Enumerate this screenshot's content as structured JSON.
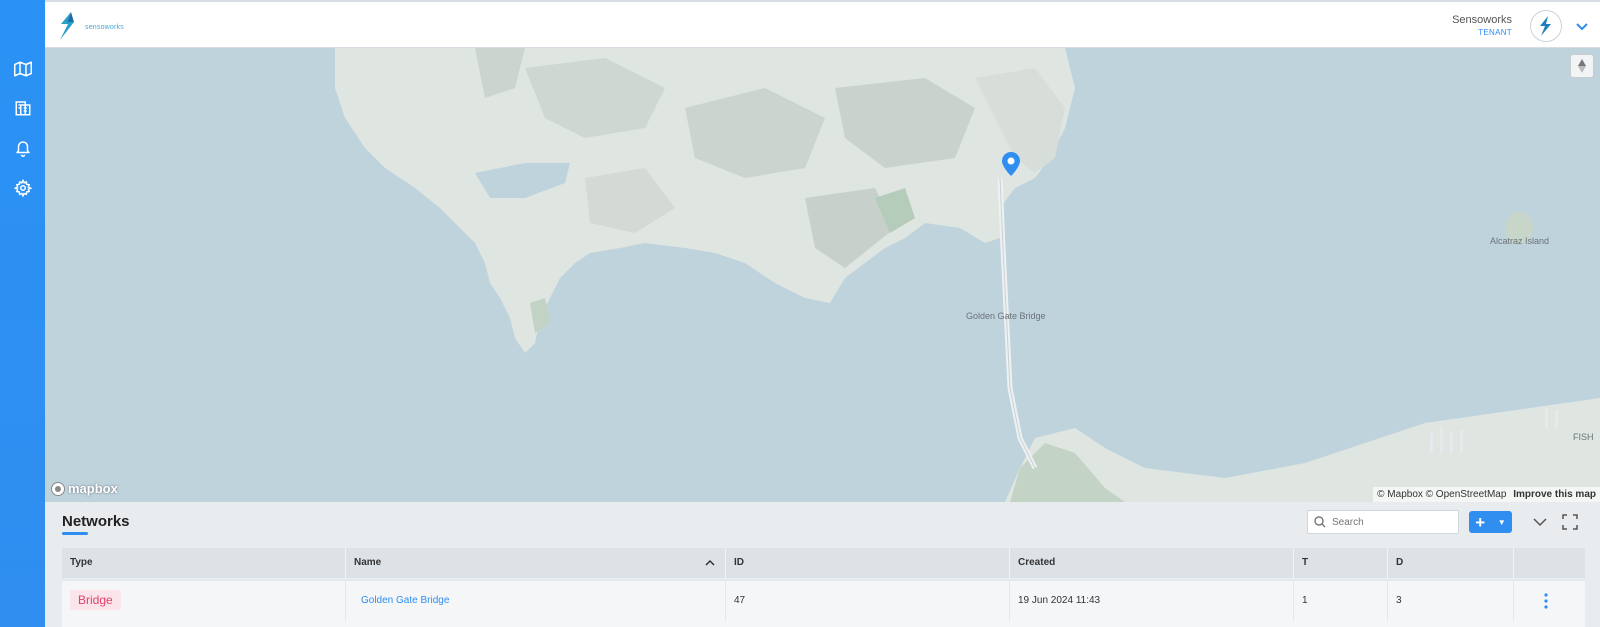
{
  "header": {
    "logo_text": "sensoworks",
    "tenant_name": "Sensoworks",
    "tenant_role": "TENANT"
  },
  "sidebar": {
    "items": [
      {
        "icon": "map-icon"
      },
      {
        "icon": "buildings-icon"
      },
      {
        "icon": "bell-icon"
      },
      {
        "icon": "gear-icon"
      }
    ]
  },
  "map": {
    "labels": {
      "bridge": "Golden Gate Bridge",
      "island": "Alcatraz Island",
      "fisherman": "FISH"
    },
    "mapbox_logo": "mapbox",
    "attribution": "© Mapbox © OpenStreetMap",
    "improve": "Improve this map"
  },
  "networks": {
    "title": "Networks",
    "search_placeholder": "Search",
    "add_label": "+",
    "columns": {
      "type": "Type",
      "name": "Name",
      "id": "ID",
      "created": "Created",
      "t": "T",
      "d": "D"
    },
    "rows": [
      {
        "type": "Bridge",
        "name": "Golden Gate Bridge",
        "id": "47",
        "created": "19 Jun 2024 11:43",
        "t": "1",
        "d": "3"
      }
    ]
  },
  "colors": {
    "accent": "#2f8ef0",
    "water": "#bfd3dd",
    "land": "#dde3df",
    "badge_bg": "#fbe4ea",
    "badge_text": "#e0426a"
  }
}
